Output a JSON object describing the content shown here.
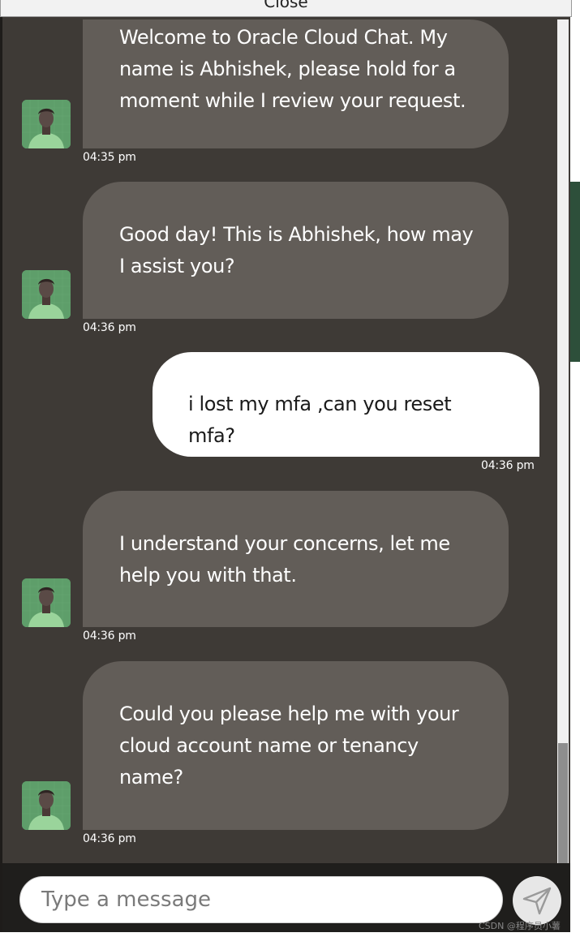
{
  "close_label": "Close",
  "messages": [
    {
      "sender": "agent",
      "text": "Welcome to Oracle Cloud Chat. My name is Abhishek, please hold for a moment while I review your request.",
      "time": "04:35 pm"
    },
    {
      "sender": "agent",
      "text": "Good day! This is Abhishek, how may I assist you?",
      "time": "04:36 pm"
    },
    {
      "sender": "user",
      "text": "i lost my mfa ,can you reset mfa?",
      "time": "04:36 pm"
    },
    {
      "sender": "agent",
      "text": "I understand your concerns, let me help you with that.",
      "time": "04:36 pm"
    },
    {
      "sender": "agent",
      "text": "Could you please help me with your cloud account name or tenancy name?",
      "time": "04:36 pm"
    }
  ],
  "input": {
    "placeholder": "Type a message",
    "value": ""
  },
  "icons": {
    "send": "send-icon",
    "avatar": "agent-avatar"
  },
  "colors": {
    "chat_background": "#3e3a36",
    "agent_bubble": "#625d58",
    "user_bubble": "#ffffff",
    "footer": "#1f1e1c",
    "avatar_bg": "#5e9e6a"
  },
  "watermark": "CSDN @程序员小薯"
}
